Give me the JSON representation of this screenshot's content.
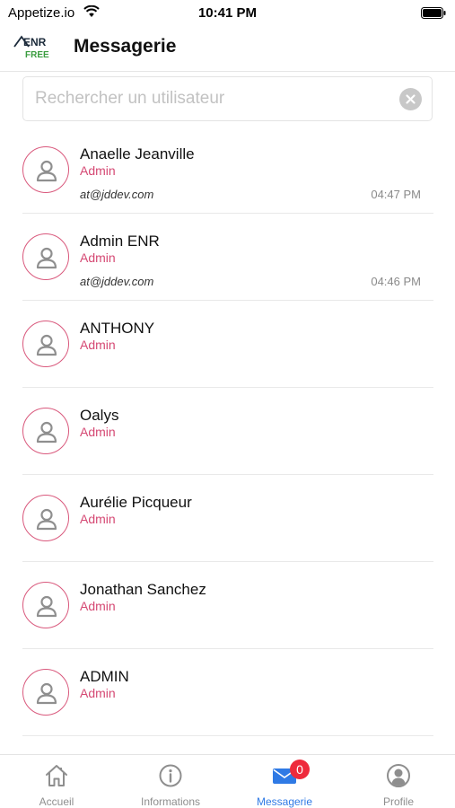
{
  "status_bar": {
    "carrier": "Appetize.io",
    "time": "10:41 PM"
  },
  "header": {
    "logo_text_top": "ENR",
    "logo_text_bottom": "FREE",
    "title": "Messagerie"
  },
  "search": {
    "placeholder": "Rechercher un utilisateur",
    "value": ""
  },
  "users": [
    {
      "name": "Anaelle Jeanville",
      "role": "Admin",
      "email": "at@jddev.com",
      "time": "04:47 PM"
    },
    {
      "name": "Admin ENR",
      "role": "Admin",
      "email": "at@jddev.com",
      "time": "04:46 PM"
    },
    {
      "name": "ANTHONY",
      "role": "Admin",
      "email": "",
      "time": ""
    },
    {
      "name": "Oalys",
      "role": "Admin",
      "email": "",
      "time": ""
    },
    {
      "name": "Aurélie Picqueur",
      "role": "Admin",
      "email": "",
      "time": ""
    },
    {
      "name": "Jonathan Sanchez",
      "role": "Admin",
      "email": "",
      "time": ""
    },
    {
      "name": "ADMIN",
      "role": "Admin",
      "email": "",
      "time": ""
    }
  ],
  "tab_bar": {
    "tabs": [
      {
        "label": "Accueil",
        "icon": "home-icon"
      },
      {
        "label": "Informations",
        "icon": "info-icon"
      },
      {
        "label": "Messagerie",
        "icon": "mail-icon",
        "badge": "0",
        "active": true
      },
      {
        "label": "Profile",
        "icon": "profile-icon"
      }
    ]
  },
  "colors": {
    "accent_role": "#d54873",
    "avatar_ring": "#d9587c",
    "active_tab": "#2f7ae5",
    "badge": "#ee2a3c",
    "logo_dark": "#1b2a3a",
    "logo_green": "#3a9c3f"
  }
}
